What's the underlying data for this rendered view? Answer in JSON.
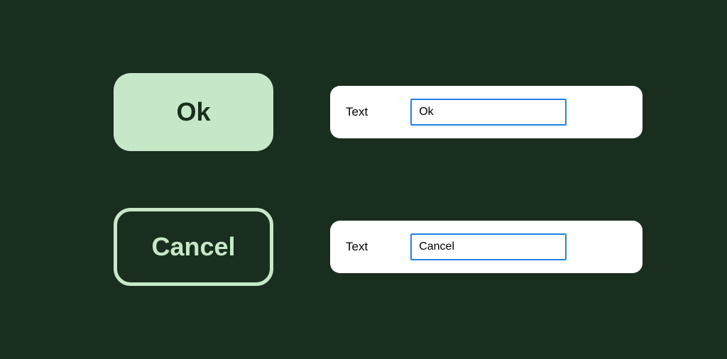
{
  "buttons": [
    {
      "label": "Ok",
      "style": "filled"
    },
    {
      "label": "Cancel",
      "style": "outlined"
    }
  ],
  "properties": [
    {
      "field_label": "Text",
      "value": "Ok"
    },
    {
      "field_label": "Text",
      "value": "Cancel"
    }
  ],
  "colors": {
    "background": "#1a2e1f",
    "button_fill": "#c6e8c8",
    "input_border": "#2383e2"
  }
}
